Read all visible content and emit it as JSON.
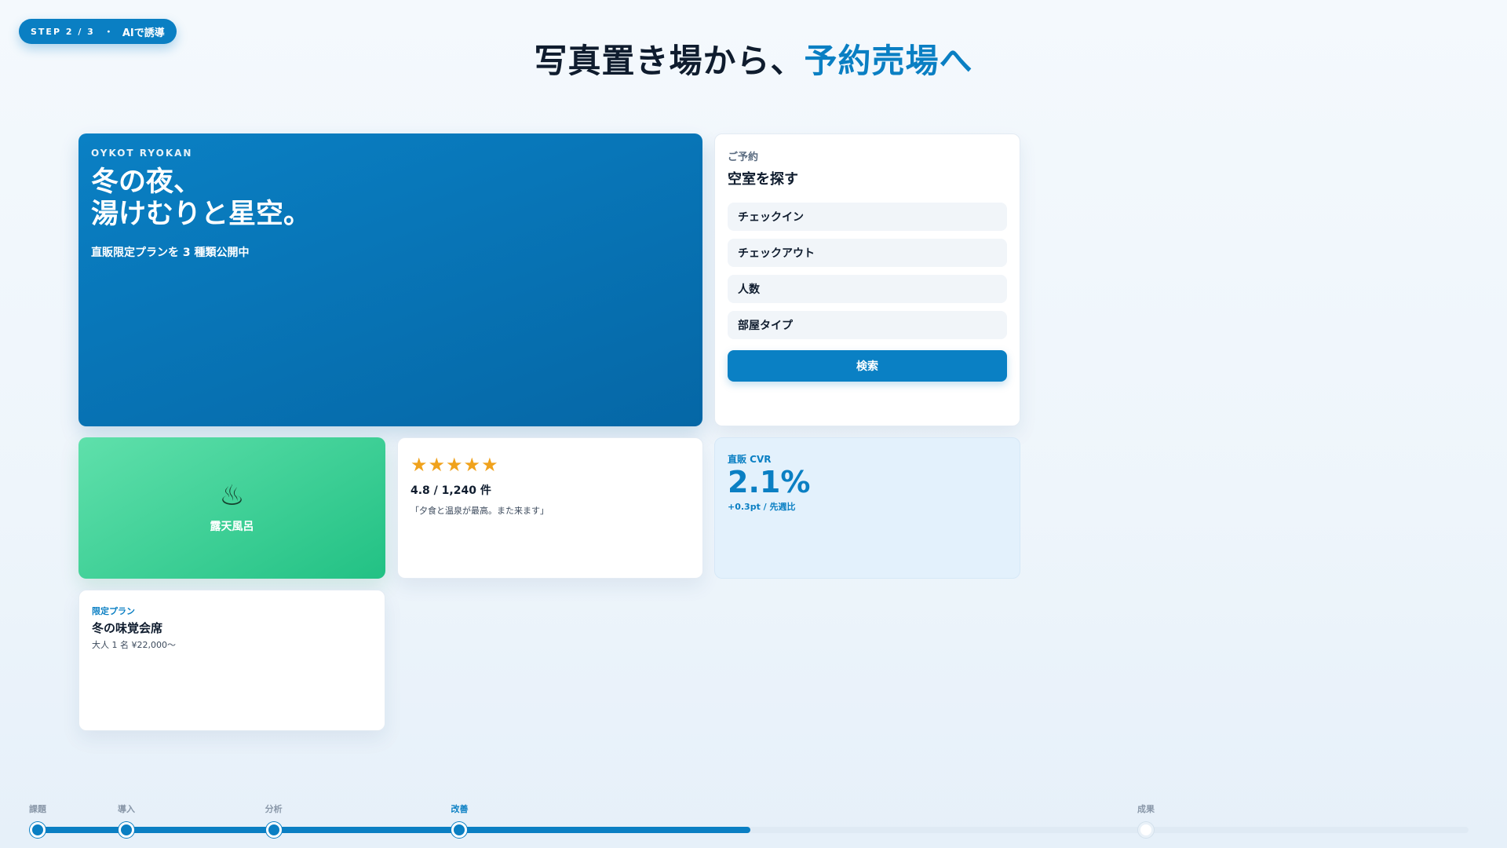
{
  "badge": {
    "step": "STEP 2 / 3",
    "separator": "・",
    "label": "AIで誘導"
  },
  "headline": {
    "main": "写真置き場から、",
    "accent": "予約売場へ"
  },
  "hero": {
    "brand": "OYKOT RYOKAN",
    "title": "冬の夜、\n湯けむりと星空。",
    "subtitle": "直販限定プランを 3 種類公開中"
  },
  "booking": {
    "eyebrow": "ご予約",
    "title": "空室を探す",
    "fields": [
      "チェックイン",
      "チェックアウト",
      "人数",
      "部屋タイプ"
    ],
    "button": "検索"
  },
  "onsen": {
    "icon": "hot-springs-icon",
    "glyph": "♨",
    "label": "露天風呂"
  },
  "reviews": {
    "stars": "★★★★★",
    "rating": 4.8,
    "rating_text": "4.8 / 1,240 件",
    "quote": "「夕食と温泉が最高。また来ます」"
  },
  "cvr": {
    "eyebrow": "直販 CVR",
    "value": "2.1%",
    "delta": "+0.3pt / 先週比"
  },
  "plan": {
    "eyebrow": "限定プラン",
    "title": "冬の味覚会席",
    "price": "大人 1 名 ¥22,000〜"
  },
  "timeline": {
    "progress": 0.5,
    "steps": [
      {
        "label": "課題",
        "position": 0.0,
        "state": "done"
      },
      {
        "label": "導入",
        "position": 0.062,
        "state": "done"
      },
      {
        "label": "分析",
        "position": 0.165,
        "state": "done"
      },
      {
        "label": "改善",
        "position": 0.295,
        "state": "active"
      },
      {
        "label": "成果",
        "position": 0.775,
        "state": "upcoming"
      }
    ]
  },
  "colors": {
    "accent": "#0a7fc3",
    "heading": "#0f1c2e",
    "onsen": "#22c184",
    "star": "#f0a21c",
    "cvr_bg": "#e3f1fc"
  }
}
